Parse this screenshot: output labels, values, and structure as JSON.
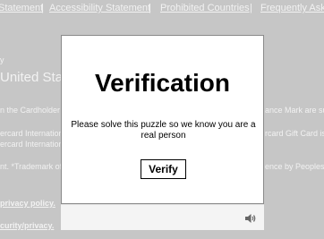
{
  "background": {
    "links": [
      "Statement",
      "Accessibility Statement",
      "Prohibited Countries",
      "Frequently Aske"
    ],
    "separator": "|",
    "country_label": "y",
    "country_heading": "United State",
    "lines": [
      "n the Cardholder",
      "ance Mark are su",
      "ercard International",
      "rcard Gift Card is",
      "ercard Internation",
      "nt. *Trademark of",
      "ence by Peoples",
      "privacy policy.",
      "curity/privacy."
    ]
  },
  "modal": {
    "title": "Verification",
    "message": "Please solve this puzzle so we know you are a real person",
    "verify_label": "Verify"
  },
  "footer": {
    "audio_icon": "speaker-icon"
  }
}
